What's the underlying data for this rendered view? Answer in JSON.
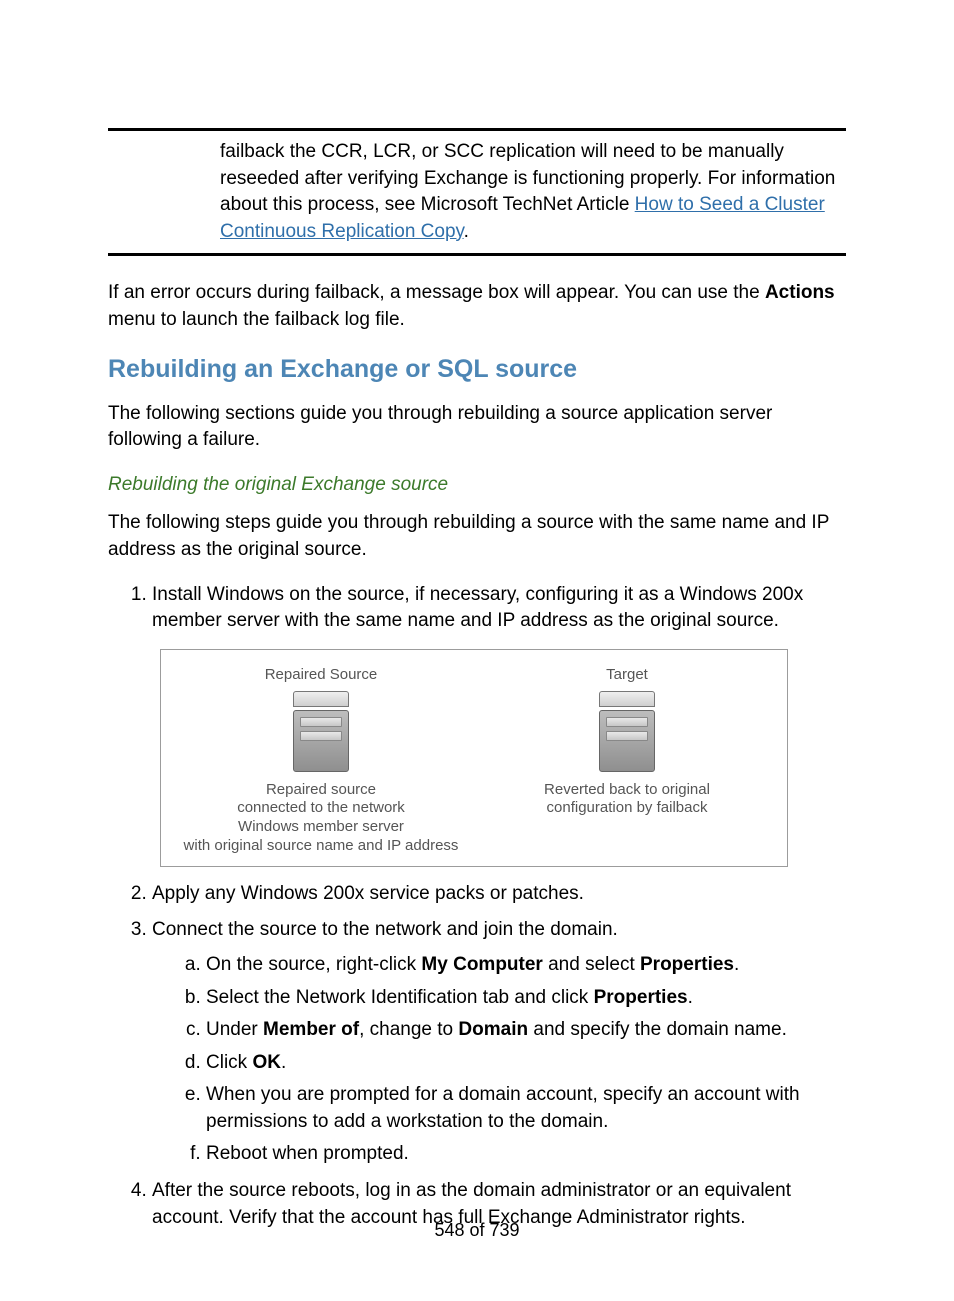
{
  "note": {
    "prefix": "failback the CCR, LCR, or SCC replication will need to be manually reseeded after verifying Exchange is functioning properly. For information about this process, see Microsoft TechNet Article ",
    "link_text": "How to Seed a Cluster Continuous Replication Copy",
    "suffix": "."
  },
  "error_para": {
    "t1": "If an error occurs during failback, a message box will appear. You can use the ",
    "bold": "Actions",
    "t2": " menu to launch the failback log file."
  },
  "section_heading": "Rebuilding an Exchange or SQL source",
  "section_intro": "The following sections guide you through rebuilding a source application server following a failure.",
  "subsection_heading": "Rebuilding the original Exchange source",
  "subsection_intro": "The following steps guide you through rebuilding a source with the same name and IP address as the original source.",
  "steps": {
    "s1": "Install Windows on the source, if necessary, configuring it as a Windows 200x member server with the same name and IP address as the original source.",
    "s2": "Apply any Windows 200x service packs or patches.",
    "s3": "Connect the source to the network and join the domain.",
    "s3a": {
      "t1": "On the source, right-click ",
      "b1": "My Computer",
      "t2": " and select ",
      "b2": "Properties",
      "t3": "."
    },
    "s3b": {
      "t1": "Select the Network Identification tab and click ",
      "b1": "Properties",
      "t2": "."
    },
    "s3c": {
      "t1": "Under ",
      "b1": "Member of",
      "t2": ", change to ",
      "b2": "Domain",
      "t3": " and specify the domain name."
    },
    "s3d": {
      "t1": "Click ",
      "b1": "OK",
      "t2": "."
    },
    "s3e": "When you are prompted for a domain account, specify an account with permissions to add a workstation to the domain.",
    "s3f": "Reboot when prompted.",
    "s4": "After the source reboots, log in as the domain administrator or an equivalent account. Verify that the account has full Exchange Administrator rights."
  },
  "diagram": {
    "left_title": "Repaired Source",
    "left_caption1": "Repaired source\nconnected to the network",
    "left_caption2": "Windows member server\nwith original source name and IP address",
    "right_title": "Target",
    "right_caption": "Reverted back to original\nconfiguration by failback"
  },
  "page_number": "548 of 739"
}
